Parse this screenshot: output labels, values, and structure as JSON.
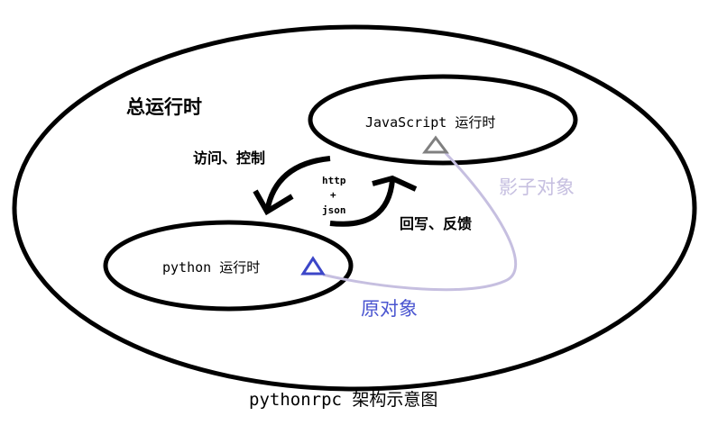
{
  "labels": {
    "total_runtime": "总运行时",
    "js_runtime": "JavaScript 运行时",
    "python_runtime": "python 运行时",
    "access_control": "访问、控制",
    "writeback_feedback": "回写、反馈",
    "protocol_line1": "http",
    "protocol_line2": "+",
    "protocol_line3": "json",
    "shadow_object": "影子对象",
    "original_object": "原对象",
    "caption": "pythonrpc 架构示意图"
  },
  "colors": {
    "outline": "#000000",
    "shadow_object": "#c6bfe0",
    "original_object": "#3c46c8",
    "shadow_triangle": "#808080"
  }
}
